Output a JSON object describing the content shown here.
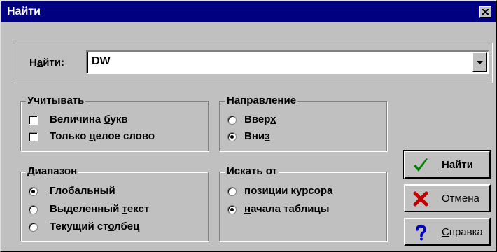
{
  "window": {
    "title": "Найти",
    "close_icon": "close-icon"
  },
  "find": {
    "label_pre": "Н",
    "label_u": "а",
    "label_post": "йти:",
    "value": "DW"
  },
  "consider": {
    "title": "Учитывать",
    "options": [
      {
        "pre": "Величина ",
        "u": "б",
        "post": "укв",
        "checked": false
      },
      {
        "pre": "Только ",
        "u": "ц",
        "post": "елое слово",
        "checked": false
      }
    ]
  },
  "direction": {
    "title": "Направление",
    "options": [
      {
        "pre": "Ввер",
        "u": "х",
        "post": "",
        "selected": false
      },
      {
        "pre": "Вни",
        "u": "з",
        "post": "",
        "selected": true
      }
    ]
  },
  "range": {
    "title": "Диапазон",
    "options": [
      {
        "pre": "",
        "u": "Г",
        "post": "лобальный",
        "selected": true
      },
      {
        "pre": "Выделенный ",
        "u": "т",
        "post": "екст",
        "selected": false
      },
      {
        "pre": "Текущий ст",
        "u": "о",
        "post": "лбец",
        "selected": false
      }
    ]
  },
  "search_from": {
    "title": "Искать от",
    "options": [
      {
        "pre": "",
        "u": "п",
        "post": "озиции курсора",
        "selected": false
      },
      {
        "pre": "",
        "u": "н",
        "post": "ачала таблицы",
        "selected": true
      }
    ]
  },
  "buttons": {
    "find": {
      "u": "Н",
      "post": "айти",
      "icon": "checkmark-icon",
      "color": "#008000"
    },
    "cancel": {
      "label": "Отмена",
      "icon": "red-x-icon",
      "color": "#c00000"
    },
    "help": {
      "u": "С",
      "post": "правка",
      "icon": "question-mark-icon",
      "color": "#0000c0"
    }
  }
}
